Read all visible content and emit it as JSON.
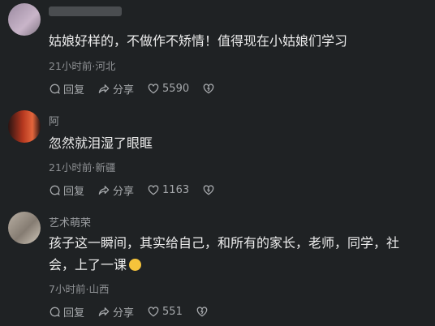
{
  "comments": [
    {
      "username": "",
      "text": "姑娘好样的，不做作不矫情！值得现在小姑娘们学习",
      "time": "21小时前",
      "location": "河北",
      "reply_label": "回复",
      "share_label": "分享",
      "likes": "5590"
    },
    {
      "username": "阿",
      "text": "忽然就泪湿了眼眶",
      "time": "21小时前",
      "location": "新疆",
      "reply_label": "回复",
      "share_label": "分享",
      "likes": "1163"
    },
    {
      "username": "艺术萌荣",
      "text": "孩子这一瞬间，其实给自己，和所有的家长，老师，同学，社会，上了一课",
      "emoji": "crying-face",
      "time": "7小时前",
      "location": "山西",
      "reply_label": "回复",
      "share_label": "分享",
      "likes": "551"
    }
  ],
  "separator": "·",
  "colors": {
    "background": "#1f2224",
    "text": "#ececec",
    "meta": "#8e9194"
  }
}
